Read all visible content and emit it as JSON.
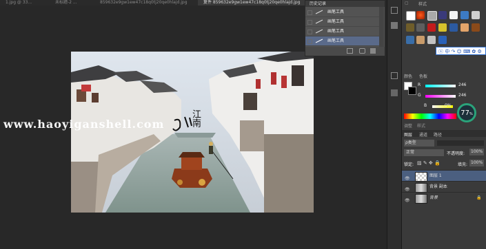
{
  "tabs": [
    {
      "label": "1.jpg @ 33..."
    },
    {
      "label": "未标题-2 ..."
    },
    {
      "label": "859632e9gw1ew47c18q0tj20qe0hlajd.jpg"
    },
    {
      "label": "复件 859632e9gw1ew47c18q0tj20qe0hlajd.jpg",
      "active": true
    }
  ],
  "history": {
    "title": "历史记录",
    "items": [
      {
        "label": "画笔工具"
      },
      {
        "label": "画笔工具"
      },
      {
        "label": "画笔工具"
      },
      {
        "label": "画笔工具",
        "selected": true
      }
    ]
  },
  "styles": {
    "title": "样式"
  },
  "color_panel": {
    "tabs": [
      "颜色",
      "色板"
    ],
    "r_label": "R",
    "r_value": "246",
    "g_label": "G",
    "g_value": "246",
    "b_label": "B",
    "b_value": "0%"
  },
  "gauge": {
    "value": "77",
    "unit": "%"
  },
  "adjust_tabs": [
    "调整",
    "样式"
  ],
  "layers_panel": {
    "tabs": [
      "图层",
      "通道",
      "路径"
    ],
    "filter": "ρ类型",
    "blend": "正常",
    "opacity_label": "不透明度:",
    "opacity_value": "100%",
    "lock_label": "锁定:",
    "fill_label": "填充:",
    "fill_value": "100%",
    "layers": [
      {
        "name": "图层 1",
        "selected": true
      },
      {
        "name": "背景 副本"
      },
      {
        "name": "背景",
        "locked": true
      }
    ]
  },
  "image_text": "江南",
  "watermark": "www.haoyiganshell.com"
}
